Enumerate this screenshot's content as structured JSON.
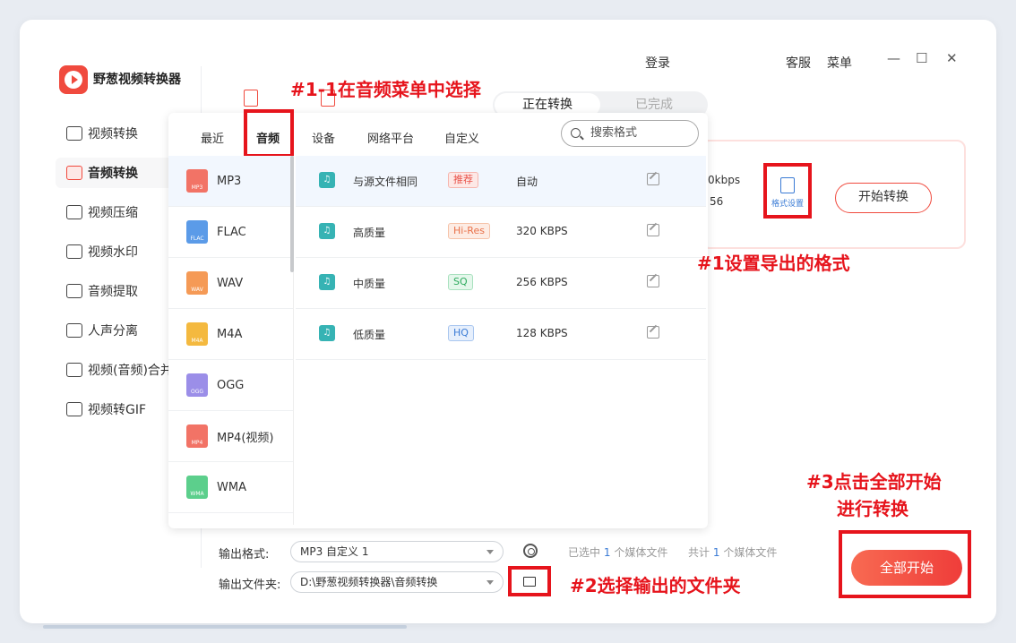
{
  "app": {
    "title": "野葱视频转换器"
  },
  "sidebar": {
    "items": [
      {
        "label": "视频转换",
        "active": false
      },
      {
        "label": "音频转换",
        "active": true
      },
      {
        "label": "视频压缩",
        "active": false
      },
      {
        "label": "视频水印",
        "active": false
      },
      {
        "label": "音频提取",
        "active": false
      },
      {
        "label": "人声分离",
        "active": false
      },
      {
        "label": "视频(音频)合并",
        "active": false
      },
      {
        "label": "视频转GIF",
        "active": false
      }
    ]
  },
  "header": {
    "login": "登录",
    "service": "客服",
    "menu": "菜单",
    "minimize": "—",
    "maximize": "☐",
    "close": "✕"
  },
  "status_tabs": {
    "active": "正在转换",
    "done": "已完成"
  },
  "task_card": {
    "bitrate_partial": "0kbps",
    "rate_partial": "56",
    "format_settings": "格式设置",
    "start_button": "开始转换"
  },
  "format_panel": {
    "tabs": [
      "最近",
      "音频",
      "设备",
      "网络平台",
      "自定义"
    ],
    "selected_tab": "音频",
    "search_placeholder": "搜索格式",
    "formats": [
      {
        "label": "MP3",
        "tag": "MP3",
        "color": "#f27366"
      },
      {
        "label": "FLAC",
        "tag": "FLAC",
        "color": "#5b9be8"
      },
      {
        "label": "WAV",
        "tag": "WAV",
        "color": "#f59a56"
      },
      {
        "label": "M4A",
        "tag": "M4A",
        "color": "#f4b93f"
      },
      {
        "label": "OGG",
        "tag": "OGG",
        "color": "#9b8ee8"
      },
      {
        "label": "MP4(视频)",
        "tag": "MP4",
        "color": "#f27366"
      },
      {
        "label": "WMA",
        "tag": "WMA",
        "color": "#5ccf8c"
      }
    ],
    "qualities": [
      {
        "name": "与源文件相同",
        "badge": "推荐",
        "badge_color": "#e8524a",
        "badge_bg": "#fde8e6",
        "rate": "自动"
      },
      {
        "name": "高质量",
        "badge": "Hi-Res",
        "badge_color": "#e8724a",
        "badge_bg": "#fdece4",
        "rate": "320 KBPS"
      },
      {
        "name": "中质量",
        "badge": "SQ",
        "badge_color": "#2eaa5e",
        "badge_bg": "#e4f7eb",
        "rate": "256 KBPS"
      },
      {
        "name": "低质量",
        "badge": "HQ",
        "badge_color": "#3a7bd5",
        "badge_bg": "#e6effc",
        "rate": "128 KBPS"
      }
    ]
  },
  "bottom": {
    "output_format_label": "输出格式:",
    "output_format_value": "MP3 自定义 1",
    "output_folder_label": "输出文件夹:",
    "output_folder_value": "D:\\野葱视频转换器\\音频转换",
    "selected_prefix": "已选中",
    "selected_count": "1",
    "selected_suffix": "个媒体文件",
    "total_prefix": "共计",
    "total_count": "1",
    "total_suffix": "个媒体文件",
    "start_all": "全部开始"
  },
  "annotations": {
    "step1_1": "#1-1在音频菜单中选择",
    "step1": "#1设置导出的格式",
    "step2": "#2选择输出的文件夹",
    "step3_line1": "#3点击全部开始",
    "step3_line2": "进行转换"
  },
  "colors": {
    "accent": "#f04a3e",
    "annotation": "#e6141c",
    "link": "#3a7bd5"
  }
}
